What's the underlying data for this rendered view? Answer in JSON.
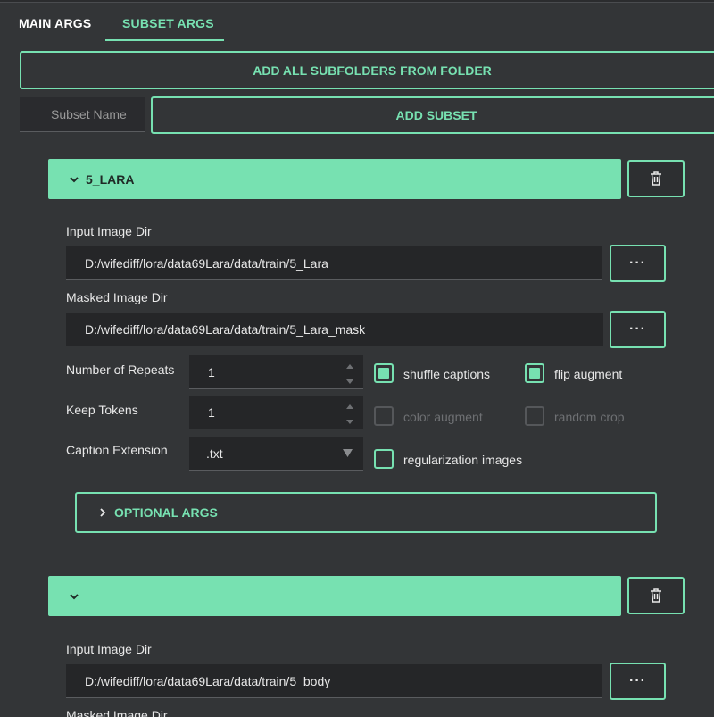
{
  "tabs": {
    "main": "MAIN ARGS",
    "subset": "SUBSET ARGS"
  },
  "toolbar": {
    "add_all_label": "ADD ALL SUBFOLDERS FROM FOLDER",
    "subset_name_placeholder": "Subset Name",
    "add_subset_label": "ADD SUBSET"
  },
  "subsets": [
    {
      "title": "5_LARA",
      "input_dir_label": "Input Image Dir",
      "input_dir_value": "D:/wifediff/lora/data69Lara/data/train/5_Lara",
      "masked_dir_label": "Masked Image Dir",
      "masked_dir_value": "D:/wifediff/lora/data69Lara/data/train/5_Lara_mask",
      "browse_label": "···",
      "repeats_label": "Number of Repeats",
      "repeats_value": "1",
      "keep_tokens_label": "Keep Tokens",
      "keep_tokens_value": "1",
      "caption_ext_label": "Caption Extension",
      "caption_ext_value": ".txt",
      "shuffle_captions": {
        "label": "shuffle captions",
        "checked": true
      },
      "flip_augment": {
        "label": "flip augment",
        "checked": true
      },
      "color_augment": {
        "label": "color augment",
        "checked": false,
        "disabled": true
      },
      "random_crop": {
        "label": "random crop",
        "checked": false,
        "disabled": true
      },
      "regularization_images": {
        "label": "regularization images",
        "checked": false
      },
      "optional_args_label": "OPTIONAL ARGS"
    },
    {
      "title": "",
      "input_dir_label": "Input Image Dir",
      "input_dir_value": "D:/wifediff/lora/data69Lara/data/train/5_body",
      "masked_dir_label": "Masked Image Dir",
      "browse_label": "···"
    }
  ],
  "colors": {
    "accent": "#77e1b1",
    "background": "#333537",
    "field": "#252628"
  },
  "icons": {
    "collapse": "chevron-down-icon",
    "expand": "chevron-right-icon",
    "delete": "trash-icon",
    "browse": "ellipsis-icon"
  }
}
